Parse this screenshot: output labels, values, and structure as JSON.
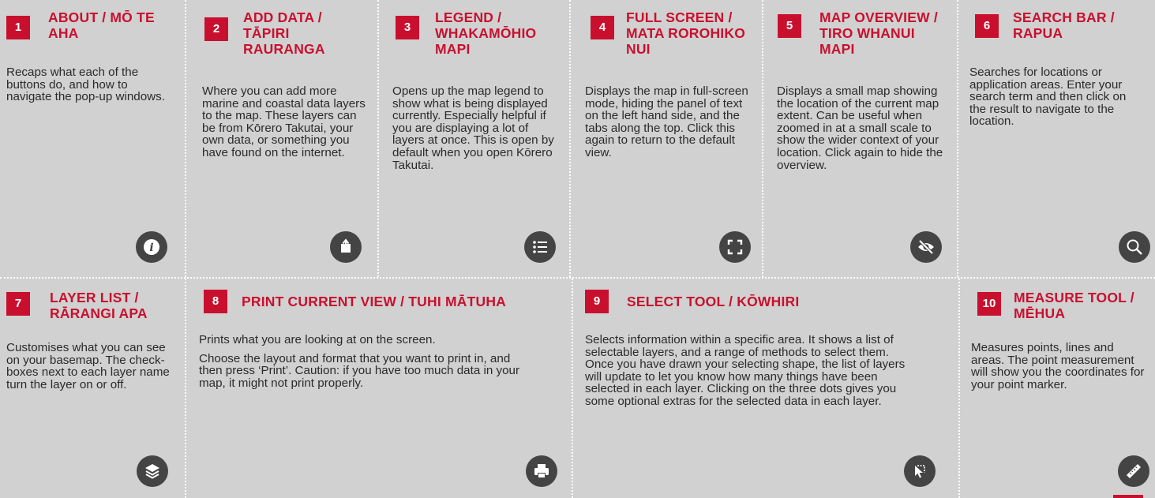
{
  "panels": [
    {
      "number": "1",
      "title": "ABOUT / MŌ TE AHA",
      "body": [
        "Recaps what each of the buttons do, and how to navigate the pop-up windows."
      ],
      "icon": "info-icon"
    },
    {
      "number": "2",
      "title": "ADD DATA / TĀPIRI RAURANGA",
      "body": [
        "Where you can add more marine and coastal data layers to the map. These layers can be from Kōrero Takutai, your own data, or something you have found on the internet."
      ],
      "icon": "add-data-icon"
    },
    {
      "number": "3",
      "title": "LEGEND / WHAKAMŌHIO MAPI",
      "body": [
        "Opens up the map legend to show what is being displayed currently. Especially helpful if you are displaying a lot of layers at once. This is open by default when you open Kōrero Takutai."
      ],
      "icon": "legend-list-icon"
    },
    {
      "number": "4",
      "title": "FULL SCREEN / MATA ROROHIKO NUI",
      "body": [
        "Displays the map in full-screen mode, hiding the panel of text on the left hand side, and the tabs along the top. Click this again to return to the default view."
      ],
      "icon": "fullscreen-icon"
    },
    {
      "number": "5",
      "title": "MAP OVERVIEW / TIRO WHANUI MAPI",
      "body": [
        "Displays a small map showing the location of the current map extent. Can be useful when zoomed in at a small scale to show the wider context of your location. Click again to hide the overview."
      ],
      "icon": "eye-slash-icon"
    },
    {
      "number": "6",
      "title": "SEARCH BAR / RAPUA",
      "body": [
        "Searches for locations or application areas. Enter your search term and then click on the result to navigate to the location."
      ],
      "icon": "search-icon"
    },
    {
      "number": "7",
      "title": "LAYER LIST / RĀRANGI APA",
      "body": [
        "Customises what you can see on your basemap. The check-boxes next to each layer name turn the layer on or off."
      ],
      "icon": "layers-icon"
    },
    {
      "number": "8",
      "title": "PRINT CURRENT VIEW / TUHI MĀTUHA",
      "body": [
        "Prints what you are looking at on the screen.",
        "Choose the layout and format that you want to print in, and then press ‘Print’. Caution: if you have too much data in your map, it might not print properly."
      ],
      "icon": "printer-icon"
    },
    {
      "number": "9",
      "title": "SELECT TOOL / KŌWHIRI",
      "body": [
        "Selects information within a specific area. It shows a list of selectable layers, and a range of methods to select them. Once you have drawn your selecting shape, the list of layers will update to let you know how many things have been selected in each layer. Clicking on the three dots gives you some optional extras for the selected data in each layer."
      ],
      "icon": "select-cursor-icon"
    },
    {
      "number": "10",
      "title": "MEASURE TOOL / MĒHUA",
      "body": [
        "Measures points, lines and areas. The point measurement will show you the coordinates for your point marker."
      ],
      "icon": "ruler-icon"
    }
  ],
  "colors": {
    "background": "#d1d1d1",
    "accent": "#c8102e",
    "icon_circle": "#444444",
    "divider": "#ffffff"
  }
}
